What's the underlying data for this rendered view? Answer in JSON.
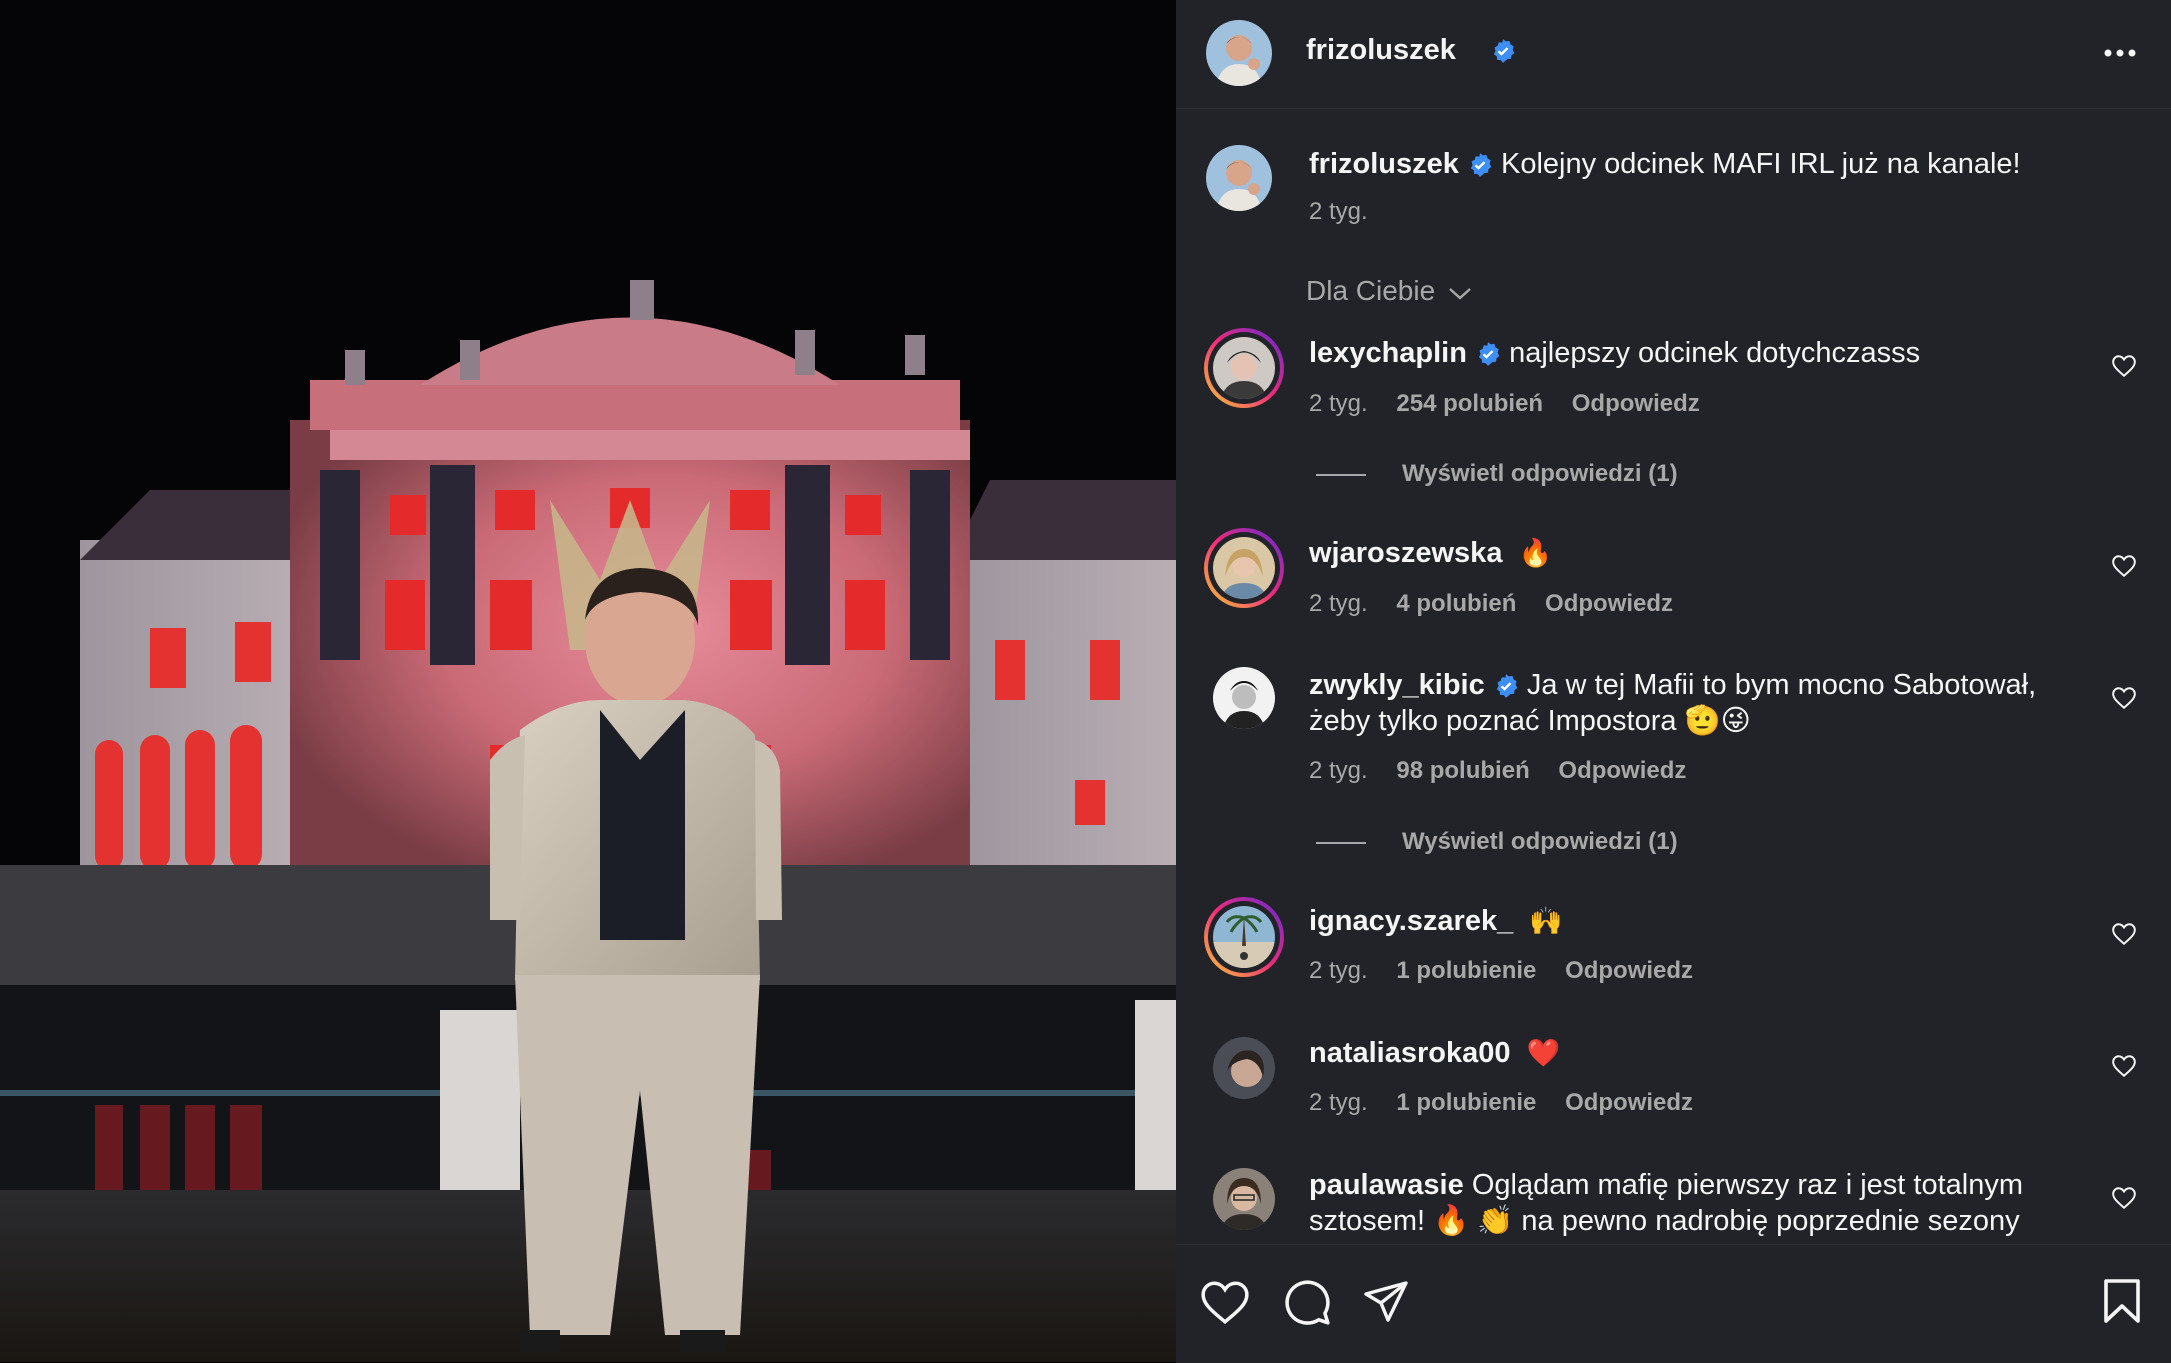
{
  "post": {
    "author": "frizoluszek",
    "caption": "Kolejny odcinek MAFI IRL już na kanale!",
    "caption_time": "2 tyg."
  },
  "sort_label": "Dla Ciebie",
  "comments": [
    {
      "user": "lexychaplin",
      "verified": true,
      "text": "najlepszy odcinek dotychczasss",
      "time": "2 tyg.",
      "likes": "254 polubień",
      "reply": "Odpowiedz",
      "view_replies": "Wyświetl odpowiedzi (1)"
    },
    {
      "user": "wjaroszewska",
      "verified": false,
      "text": "🔥",
      "time": "2 tyg.",
      "likes": "4 polubień",
      "reply": "Odpowiedz"
    },
    {
      "user": "zwykly_kibic",
      "verified": true,
      "text": "Ja w tej Mafii to bym mocno Sabotował,",
      "text2": "żeby tylko poznać Impostora 🫡😜",
      "time": "2 tyg.",
      "likes": "98 polubień",
      "reply": "Odpowiedz",
      "view_replies": "Wyświetl odpowiedzi (1)"
    },
    {
      "user": "ignacy.szarek_",
      "verified": false,
      "text": "🙌",
      "time": "2 tyg.",
      "likes": "1 polubienie",
      "reply": "Odpowiedz"
    },
    {
      "user": "nataliasroka00",
      "verified": false,
      "text": "❤️",
      "time": "2 tyg.",
      "likes": "1 polubienie",
      "reply": "Odpowiedz"
    },
    {
      "user": "paulawasie",
      "verified": false,
      "text": "Oglądam mafię pierwszy raz i jest totalnym",
      "text2": "sztosem! 🔥 👏 na pewno nadrobię poprzednie sezony"
    }
  ],
  "colors": {
    "panel_bg": "#212328",
    "verified": "#3d8ff5",
    "muted": "#a8a8a8",
    "heart_red": "#ff3040"
  },
  "icons": [
    "more-icon",
    "verified-icon",
    "chevron-down-icon",
    "heart-icon",
    "comment-icon",
    "share-icon",
    "bookmark-icon"
  ]
}
